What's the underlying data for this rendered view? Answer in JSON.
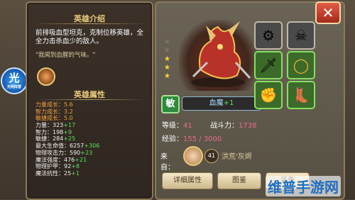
{
  "intro": {
    "title": "英雄介绍",
    "description": "前排吸血型坦克，克制位移英雄，全全力击杀血少的敌人。",
    "quote": "\"我闻到血腥的气味。\""
  },
  "attributes": {
    "title": "英雄属性",
    "growth": [
      "力量成长：5.6",
      "智力成长：3.2",
      "敏捷成长：5.0"
    ],
    "stats": [
      {
        "label": "力量：323",
        "bonus": "+17"
      },
      {
        "label": "智力：198",
        "bonus": "+9"
      },
      {
        "label": "敏捷：284",
        "bonus": "+25"
      },
      {
        "label": "最大生命值：6257",
        "bonus": "+306"
      },
      {
        "label": "物理攻击力：590",
        "bonus": "+23"
      },
      {
        "label": "魔法强度：476",
        "bonus": "+21"
      },
      {
        "label": "物理护甲：92",
        "bonus": "+8"
      },
      {
        "label": "魔法抗性：25",
        "bonus": "+1"
      }
    ]
  },
  "side_badge": {
    "char": "光",
    "sub": "光明阵营"
  },
  "hero": {
    "class_icon": "敏",
    "name": "血魔",
    "plus": "+1",
    "stars_total": 5,
    "stars_filled": 3
  },
  "hero_stats": {
    "level_label": "等级：",
    "level_value": "41",
    "power_label": "战斗力：",
    "power_value": "1738",
    "exp_label": "经验：",
    "exp_value": "155 / 3000"
  },
  "source": {
    "label": "来自：",
    "level": "41",
    "name": "洪荒'灰烬"
  },
  "equipment": [
    {
      "name": "locked-armor",
      "icon": "⚙",
      "filled": false
    },
    {
      "name": "locked-helmet",
      "icon": "☠",
      "filled": false
    },
    {
      "name": "dagger",
      "icon": "🗡",
      "filled": true
    },
    {
      "name": "ring",
      "icon": "◯",
      "filled": true
    },
    {
      "name": "gloves",
      "icon": "✊",
      "filled": true
    },
    {
      "name": "boots",
      "icon": "👢",
      "filled": true
    }
  ],
  "buttons": {
    "detail": "详细属性",
    "guide": "图鉴",
    "third": "装备"
  },
  "close_label": "✕",
  "watermark": "维普手游网"
}
